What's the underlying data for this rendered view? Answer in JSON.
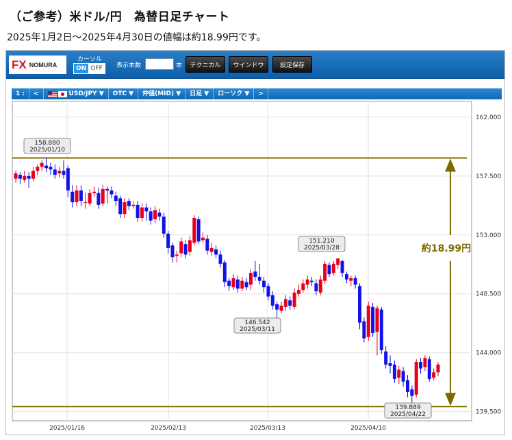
{
  "heading": "（ご参考）米ドル/円　為替日足チャート",
  "subheading": "2025年1月2日〜2025年4月30日の値幅は約18.99円です。",
  "toolbar": {
    "logo_fx": "FX",
    "logo_text": "NOMURA",
    "cursor_label": "カーソル",
    "toggle_on": "ON",
    "toggle_off": "OFF",
    "count_label": "表示本数",
    "count_value": "",
    "count_unit": "本",
    "technical": "テクニカル",
    "window": "ウインドウ",
    "save_settings": "設定保存"
  },
  "subbar": {
    "pane": "1 :",
    "prev": "<",
    "pair": "USD/JPY ▼",
    "market": "OTC ▼",
    "price_type": "仲値(MID) ▼",
    "period": "日足 ▼",
    "style": "ローソク ▼",
    "next": ">"
  },
  "colors": {
    "up": "#e8001b",
    "down": "#1212e8",
    "level_line": "#7d6a00",
    "toolbar": "#1565b0"
  },
  "chart_data": {
    "type": "candlestick",
    "ylim": [
      138.8,
      163.2
    ],
    "yticks": [
      "162.000",
      "157.500",
      "153.000",
      "148.500",
      "144.000",
      "139.500"
    ],
    "xticks": [
      "2025/01/16",
      "2025/02/13",
      "2025/03/13",
      "2025/04/10"
    ],
    "grid": true,
    "range_label": "約18.99円",
    "annotations": [
      {
        "price": "158.880",
        "date": "2025/01/10"
      },
      {
        "price": "151.210",
        "date": "2025/03/28"
      },
      {
        "price": "146.542",
        "date": "2025/03/11"
      },
      {
        "price": "139.889",
        "date": "2025/04/22"
      }
    ],
    "high_level": 158.88,
    "low_level": 139.889,
    "candles": [
      {
        "o": 157.3,
        "c": 157.7,
        "h": 157.9,
        "l": 157.0
      },
      {
        "o": 157.6,
        "c": 157.3,
        "h": 157.8,
        "l": 156.9
      },
      {
        "o": 157.2,
        "c": 157.5,
        "h": 157.9,
        "l": 157.0
      },
      {
        "o": 157.5,
        "c": 157.3,
        "h": 157.8,
        "l": 156.6
      },
      {
        "o": 157.3,
        "c": 157.9,
        "h": 158.2,
        "l": 157.1
      },
      {
        "o": 157.9,
        "c": 158.2,
        "h": 158.4,
        "l": 157.6
      },
      {
        "o": 158.2,
        "c": 158.5,
        "h": 158.7,
        "l": 157.9
      },
      {
        "o": 158.3,
        "c": 158.1,
        "h": 158.88,
        "l": 157.8
      },
      {
        "o": 158.2,
        "c": 158.0,
        "h": 158.5,
        "l": 157.6
      },
      {
        "o": 158.0,
        "c": 157.6,
        "h": 158.4,
        "l": 157.3
      },
      {
        "o": 157.7,
        "c": 157.9,
        "h": 158.2,
        "l": 157.4
      },
      {
        "o": 157.9,
        "c": 157.6,
        "h": 158.7,
        "l": 157.3
      },
      {
        "o": 158.1,
        "c": 156.4,
        "h": 158.3,
        "l": 155.9
      },
      {
        "o": 156.3,
        "c": 155.5,
        "h": 156.8,
        "l": 155.1
      },
      {
        "o": 155.5,
        "c": 156.4,
        "h": 156.8,
        "l": 155.2
      },
      {
        "o": 156.4,
        "c": 155.6,
        "h": 156.8,
        "l": 155.2
      },
      {
        "o": 155.5,
        "c": 155.5,
        "h": 156.2,
        "l": 155.0
      },
      {
        "o": 155.4,
        "c": 156.2,
        "h": 156.5,
        "l": 155.2
      },
      {
        "o": 156.2,
        "c": 156.3,
        "h": 156.7,
        "l": 155.9
      },
      {
        "o": 156.2,
        "c": 155.3,
        "h": 156.6,
        "l": 155.0
      },
      {
        "o": 155.4,
        "c": 156.5,
        "h": 156.8,
        "l": 155.2
      },
      {
        "o": 156.5,
        "c": 156.4,
        "h": 156.7,
        "l": 155.4
      },
      {
        "o": 156.4,
        "c": 156.1,
        "h": 156.7,
        "l": 155.8
      },
      {
        "o": 156.0,
        "c": 155.6,
        "h": 156.3,
        "l": 155.2
      },
      {
        "o": 155.8,
        "c": 154.6,
        "h": 156.0,
        "l": 154.3
      },
      {
        "o": 154.6,
        "c": 155.5,
        "h": 155.8,
        "l": 154.3
      },
      {
        "o": 155.6,
        "c": 155.2,
        "h": 155.8,
        "l": 154.9
      },
      {
        "o": 155.2,
        "c": 155.3,
        "h": 155.6,
        "l": 155.0
      },
      {
        "o": 155.3,
        "c": 154.3,
        "h": 155.6,
        "l": 154.0
      },
      {
        "o": 154.3,
        "c": 155.1,
        "h": 155.4,
        "l": 154.0
      },
      {
        "o": 155.1,
        "c": 154.8,
        "h": 155.4,
        "l": 154.1
      },
      {
        "o": 154.8,
        "c": 154.1,
        "h": 155.1,
        "l": 153.8
      },
      {
        "o": 154.2,
        "c": 154.9,
        "h": 155.2,
        "l": 153.9
      },
      {
        "o": 154.7,
        "c": 154.4,
        "h": 155.0,
        "l": 154.1
      },
      {
        "o": 154.4,
        "c": 153.1,
        "h": 154.7,
        "l": 152.8
      },
      {
        "o": 153.1,
        "c": 152.0,
        "h": 153.3,
        "l": 151.6
      },
      {
        "o": 152.2,
        "c": 151.3,
        "h": 152.4,
        "l": 150.9
      },
      {
        "o": 151.4,
        "c": 151.5,
        "h": 151.8,
        "l": 150.9
      },
      {
        "o": 151.6,
        "c": 152.5,
        "h": 152.8,
        "l": 151.3
      },
      {
        "o": 152.3,
        "c": 151.5,
        "h": 152.6,
        "l": 151.2
      },
      {
        "o": 151.7,
        "c": 152.6,
        "h": 152.9,
        "l": 151.4
      },
      {
        "o": 152.4,
        "c": 154.3,
        "h": 154.5,
        "l": 152.2
      },
      {
        "o": 154.2,
        "c": 152.5,
        "h": 154.4,
        "l": 152.3
      },
      {
        "o": 152.6,
        "c": 152.8,
        "h": 153.2,
        "l": 152.4
      },
      {
        "o": 152.7,
        "c": 151.8,
        "h": 153.0,
        "l": 151.5
      },
      {
        "o": 151.7,
        "c": 152.0,
        "h": 152.4,
        "l": 151.4
      },
      {
        "o": 151.9,
        "c": 151.5,
        "h": 152.2,
        "l": 151.2
      },
      {
        "o": 151.5,
        "c": 150.8,
        "h": 151.8,
        "l": 150.5
      },
      {
        "o": 150.9,
        "c": 149.4,
        "h": 151.1,
        "l": 149.0
      },
      {
        "o": 149.5,
        "c": 149.1,
        "h": 149.7,
        "l": 148.7
      },
      {
        "o": 149.0,
        "c": 149.7,
        "h": 150.0,
        "l": 148.8
      },
      {
        "o": 149.6,
        "c": 148.9,
        "h": 149.9,
        "l": 148.6
      },
      {
        "o": 148.9,
        "c": 149.5,
        "h": 149.8,
        "l": 148.7
      },
      {
        "o": 149.4,
        "c": 149.0,
        "h": 149.7,
        "l": 148.8
      },
      {
        "o": 149.2,
        "c": 150.1,
        "h": 150.4,
        "l": 148.8
      },
      {
        "o": 150.2,
        "c": 149.8,
        "h": 151.0,
        "l": 149.5
      },
      {
        "o": 149.8,
        "c": 149.5,
        "h": 150.8,
        "l": 149.2
      },
      {
        "o": 149.5,
        "c": 149.0,
        "h": 149.8,
        "l": 148.6
      },
      {
        "o": 149.1,
        "c": 148.3,
        "h": 149.3,
        "l": 148.0
      },
      {
        "o": 148.4,
        "c": 147.6,
        "h": 148.7,
        "l": 147.3
      },
      {
        "o": 147.7,
        "c": 147.3,
        "h": 147.9,
        "l": 146.542
      },
      {
        "o": 147.2,
        "c": 147.6,
        "h": 147.9,
        "l": 147.0
      },
      {
        "o": 147.5,
        "c": 148.1,
        "h": 148.4,
        "l": 147.2
      },
      {
        "o": 148.0,
        "c": 147.6,
        "h": 148.3,
        "l": 147.3
      },
      {
        "o": 147.5,
        "c": 148.6,
        "h": 148.9,
        "l": 147.3
      },
      {
        "o": 148.5,
        "c": 148.8,
        "h": 149.2,
        "l": 148.3
      },
      {
        "o": 148.8,
        "c": 149.3,
        "h": 149.6,
        "l": 148.6
      },
      {
        "o": 149.2,
        "c": 149.6,
        "h": 149.9,
        "l": 148.9
      },
      {
        "o": 149.5,
        "c": 149.4,
        "h": 149.8,
        "l": 149.1
      },
      {
        "o": 149.3,
        "c": 148.7,
        "h": 149.6,
        "l": 148.4
      },
      {
        "o": 148.6,
        "c": 149.6,
        "h": 149.9,
        "l": 148.4
      },
      {
        "o": 149.5,
        "c": 150.8,
        "h": 151.0,
        "l": 149.3
      },
      {
        "o": 150.7,
        "c": 150.0,
        "h": 150.9,
        "l": 149.8
      },
      {
        "o": 150.1,
        "c": 150.8,
        "h": 151.0,
        "l": 149.9
      },
      {
        "o": 150.7,
        "c": 151.2,
        "h": 151.21,
        "l": 150.4
      },
      {
        "o": 151.0,
        "c": 150.1,
        "h": 151.1,
        "l": 149.8
      },
      {
        "o": 150.0,
        "c": 149.6,
        "h": 150.2,
        "l": 149.3
      },
      {
        "o": 149.5,
        "c": 149.7,
        "h": 149.9,
        "l": 149.1
      },
      {
        "o": 149.7,
        "c": 149.2,
        "h": 149.9,
        "l": 148.9
      },
      {
        "o": 149.1,
        "c": 146.3,
        "h": 149.3,
        "l": 145.8
      },
      {
        "o": 146.4,
        "c": 145.1,
        "h": 146.7,
        "l": 144.8
      },
      {
        "o": 145.2,
        "c": 147.6,
        "h": 147.9,
        "l": 144.9
      },
      {
        "o": 147.5,
        "c": 145.5,
        "h": 147.8,
        "l": 145.2
      },
      {
        "o": 145.6,
        "c": 147.4,
        "h": 147.6,
        "l": 143.8
      },
      {
        "o": 147.3,
        "c": 144.2,
        "h": 147.5,
        "l": 143.9
      },
      {
        "o": 144.1,
        "c": 143.1,
        "h": 144.5,
        "l": 142.8
      },
      {
        "o": 143.2,
        "c": 143.0,
        "h": 143.8,
        "l": 142.4
      },
      {
        "o": 143.1,
        "c": 142.0,
        "h": 143.4,
        "l": 141.7
      },
      {
        "o": 142.1,
        "c": 142.7,
        "h": 143.0,
        "l": 141.6
      },
      {
        "o": 142.6,
        "c": 141.8,
        "h": 142.9,
        "l": 141.4
      },
      {
        "o": 141.9,
        "c": 141.0,
        "h": 142.3,
        "l": 140.6
      },
      {
        "o": 141.2,
        "c": 140.7,
        "h": 141.5,
        "l": 139.889
      },
      {
        "o": 140.8,
        "c": 143.3,
        "h": 143.5,
        "l": 140.6
      },
      {
        "o": 143.3,
        "c": 142.8,
        "h": 143.6,
        "l": 142.4
      },
      {
        "o": 142.9,
        "c": 143.6,
        "h": 143.8,
        "l": 142.6
      },
      {
        "o": 143.5,
        "c": 142.0,
        "h": 143.7,
        "l": 141.8
      },
      {
        "o": 142.1,
        "c": 142.5,
        "h": 142.8,
        "l": 141.9
      },
      {
        "o": 142.5,
        "c": 143.1,
        "h": 143.3,
        "l": 142.2
      }
    ]
  }
}
